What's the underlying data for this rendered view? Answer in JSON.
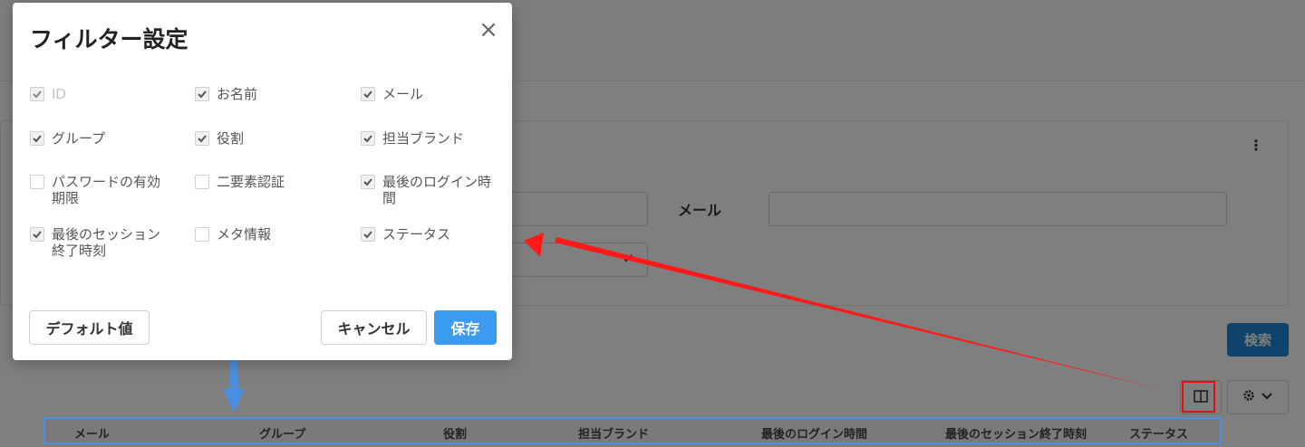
{
  "modal": {
    "title": "フィルター設定",
    "close_icon": "close-icon",
    "options": [
      {
        "key": "id",
        "label": "ID",
        "checked": true,
        "disabled": true
      },
      {
        "key": "name",
        "label": "お名前",
        "checked": true,
        "disabled": false
      },
      {
        "key": "email",
        "label": "メール",
        "checked": true,
        "disabled": false
      },
      {
        "key": "group",
        "label": "グループ",
        "checked": true,
        "disabled": false
      },
      {
        "key": "role",
        "label": "役割",
        "checked": true,
        "disabled": false
      },
      {
        "key": "brand",
        "label": "担当ブランド",
        "checked": true,
        "disabled": false
      },
      {
        "key": "pw_expiry",
        "label_line1": "パスワードの有効",
        "label_line2": "期限",
        "checked": false,
        "disabled": false
      },
      {
        "key": "two_factor",
        "label": "二要素認証",
        "checked": false,
        "disabled": false
      },
      {
        "key": "last_login",
        "label_line1": "最後のログイン時",
        "label_line2": "間",
        "checked": true,
        "disabled": false
      },
      {
        "key": "last_session",
        "label_line1": "最後のセッション",
        "label_line2": "終了時刻",
        "checked": true,
        "disabled": false
      },
      {
        "key": "meta",
        "label": "メタ情報",
        "checked": false,
        "disabled": false
      },
      {
        "key": "status",
        "label": "ステータス",
        "checked": true,
        "disabled": false
      }
    ],
    "buttons": {
      "default_label": "デフォルト値",
      "cancel_label": "キャンセル",
      "save_label": "保存"
    }
  },
  "background": {
    "email_label": "メール",
    "search_label": "検索",
    "table_headers": [
      "メール",
      "グループ",
      "役割",
      "担当ブランド",
      "最後のログイン時間",
      "最後のセッション終了時刻",
      "ステータス"
    ]
  },
  "colors": {
    "primary": "#3a9bf0",
    "search_button": "#1e86d6",
    "annotation_red": "#ff0000",
    "annotation_blue": "#4a90e2"
  }
}
